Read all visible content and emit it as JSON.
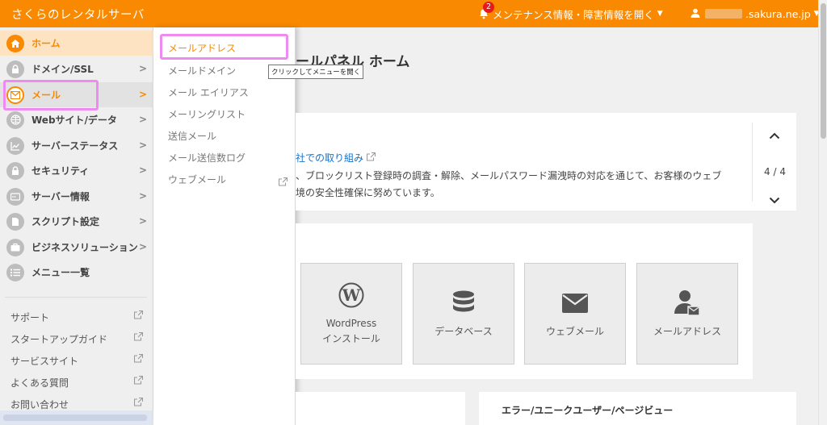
{
  "header": {
    "app_title": "さくらのレンタルサーバ",
    "notification_count": "2",
    "maintenance_label": "メンテナンス情報・障害情報を開く",
    "user_domain": ".sakura.ne.jp"
  },
  "sidebar": {
    "items": [
      {
        "label": "ホーム",
        "icon": "home-icon"
      },
      {
        "label": "ドメイン/SSL",
        "icon": "lock-icon"
      },
      {
        "label": "メール",
        "icon": "envelope-icon"
      },
      {
        "label": "Webサイト/データ",
        "icon": "globe-icon"
      },
      {
        "label": "サーバーステータス",
        "icon": "chart-icon"
      },
      {
        "label": "セキュリティ",
        "icon": "lock-icon"
      },
      {
        "label": "サーバー情報",
        "icon": "server-icon"
      },
      {
        "label": "スクリプト設定",
        "icon": "code-icon"
      },
      {
        "label": "ビジネスソリューション",
        "icon": "briefcase-icon"
      },
      {
        "label": "メニュー一覧",
        "icon": "list-icon"
      }
    ],
    "links": [
      {
        "label": "サポート"
      },
      {
        "label": "スタートアップガイド"
      },
      {
        "label": "サービスサイト"
      },
      {
        "label": "よくある質問"
      },
      {
        "label": "お問い合わせ"
      }
    ]
  },
  "submenu": {
    "items": [
      {
        "label": "メールアドレス"
      },
      {
        "label": "メールドメイン"
      },
      {
        "label": "メール エイリアス"
      },
      {
        "label": "メーリングリスト"
      },
      {
        "label": "送信メール"
      },
      {
        "label": "メール送信数ログ"
      },
      {
        "label": "ウェブメール"
      }
    ]
  },
  "tooltip": "クリックしてメニューを開く",
  "main": {
    "page_title": "ールパネル ホーム",
    "news": {
      "link": "社での取り組み",
      "line1": "、ブロックリスト登録時の調査・解除、メールパスワード漏洩時の対応を通じて、お客様のウェブ",
      "line2": "境の安全性確保に努めています。",
      "pager": "4 / 4"
    },
    "tiles": [
      {
        "label1": "WordPress",
        "label2": "インストール",
        "icon": "wordpress-icon"
      },
      {
        "label1": "データベース",
        "label2": "",
        "icon": "database-icon"
      },
      {
        "label1": "ウェブメール",
        "label2": "",
        "icon": "envelope-icon"
      },
      {
        "label1": "メールアドレス",
        "label2": "",
        "icon": "user-mail-icon"
      }
    ],
    "stats_heading": "エラー/ユニークユーザー/ページビュー"
  },
  "colors": {
    "brand": "#f98900",
    "highlight": "#ef8af2",
    "link": "#1a73c8",
    "badge": "#e8181c"
  }
}
